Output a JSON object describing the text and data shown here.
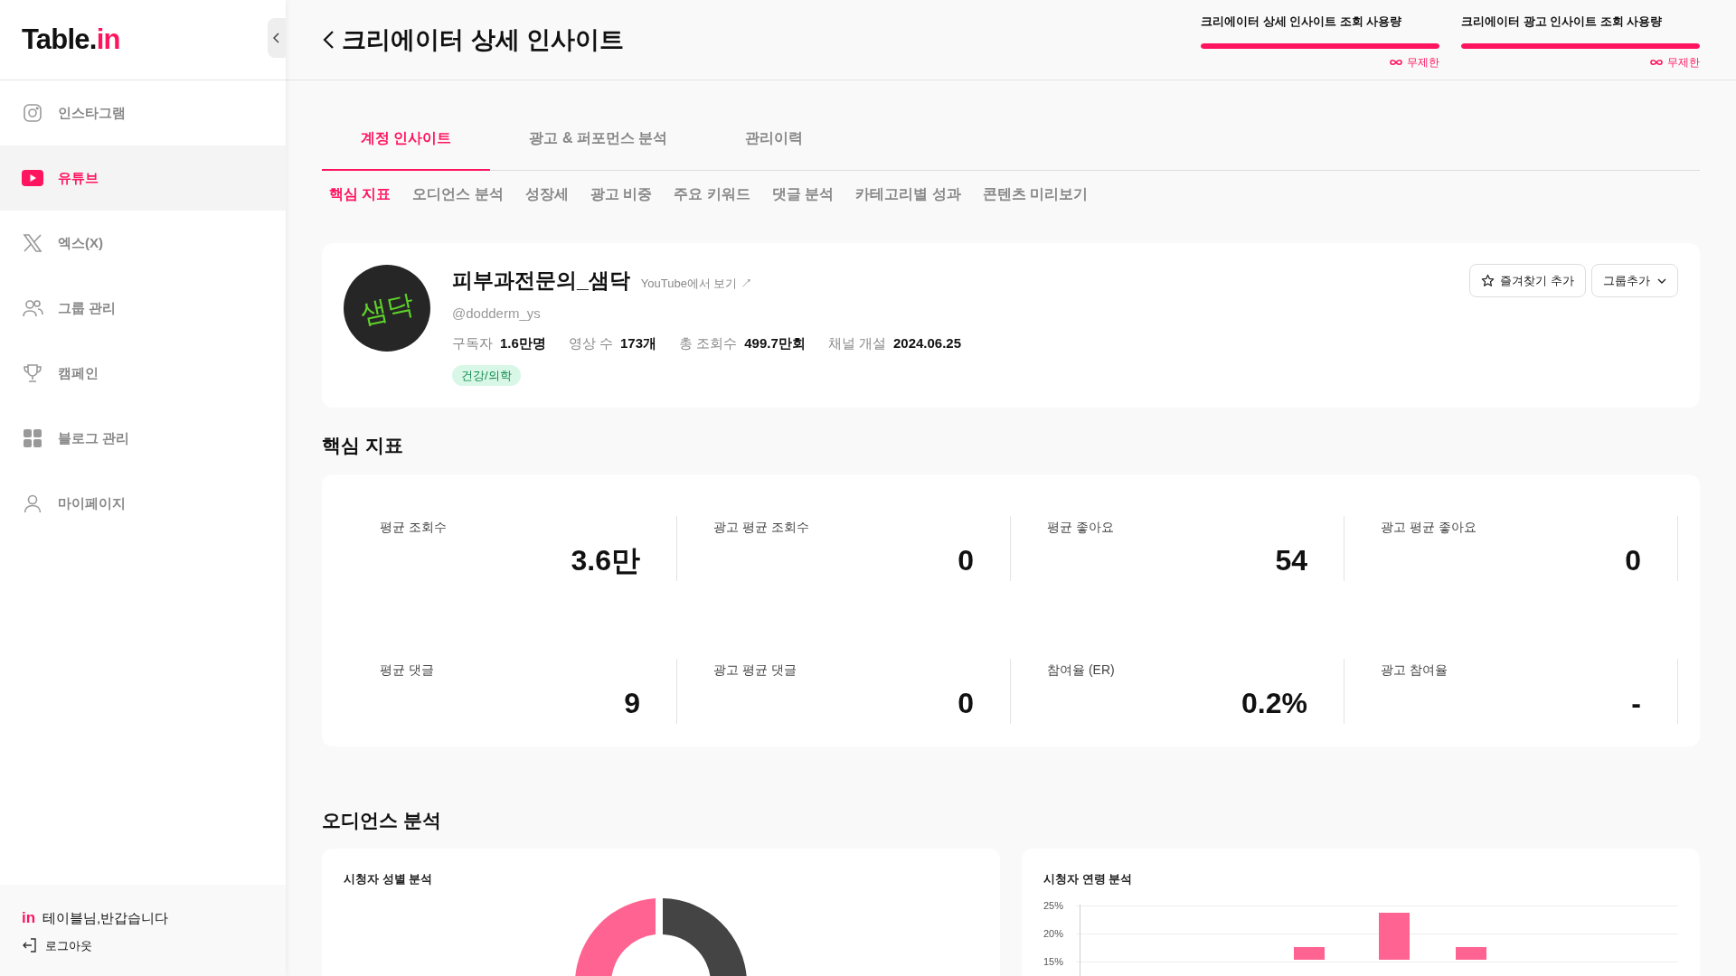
{
  "sidebar": {
    "logo": {
      "main": "Table.",
      "accent": "in"
    },
    "items": [
      {
        "label": "인스타그램",
        "kind": "instagram",
        "selected": false
      },
      {
        "label": "유튜브",
        "kind": "youtube",
        "selected": true
      },
      {
        "label": "엑스(X)",
        "kind": "x",
        "selected": false
      },
      {
        "label": "그룹 관리",
        "kind": "group",
        "selected": false
      },
      {
        "label": "캠페인",
        "kind": "trophy",
        "selected": false
      },
      {
        "label": "블로그 관리",
        "kind": "grid",
        "selected": false
      },
      {
        "label": "마이페이지",
        "kind": "user",
        "selected": false
      }
    ],
    "footer": {
      "badge": "in",
      "greeting": "테이블님,반갑습니다",
      "logout": "로그아웃"
    }
  },
  "header": {
    "title": "크리에이터 상세 인사이트",
    "usage": [
      {
        "label": "크리에이터 상세 인사이트 조회 사용량",
        "level": 1,
        "limit": "무제한"
      },
      {
        "label": "크리에이터 광고 인사이트 조회 사용량",
        "level": 1,
        "limit": "무제한"
      }
    ]
  },
  "tabs": [
    {
      "label": "계정 인사이트",
      "selected": true
    },
    {
      "label": "광고 & 퍼포먼스 분석",
      "selected": false
    },
    {
      "label": "관리이력",
      "selected": false
    }
  ],
  "subtabs": [
    {
      "label": "핵심 지표",
      "selected": true
    },
    {
      "label": "오디언스 분석",
      "selected": false
    },
    {
      "label": "성장세",
      "selected": false
    },
    {
      "label": "광고 비중",
      "selected": false
    },
    {
      "label": "주요 키워드",
      "selected": false
    },
    {
      "label": "댓글 분석",
      "selected": false
    },
    {
      "label": "카테고리별 성과",
      "selected": false
    },
    {
      "label": "콘텐츠 미리보기",
      "selected": false
    }
  ],
  "profile": {
    "avatar_text": "샘닥",
    "name": "피부과전문의_샘닥",
    "link": "YouTube에서 보기 ↗",
    "handle": "@dodderm_ys",
    "stats": [
      {
        "label": "구독자",
        "value": "1.6만명"
      },
      {
        "label": "영상 수",
        "value": "173개"
      },
      {
        "label": "총 조회수",
        "value": "499.7만회"
      },
      {
        "label": "채널 개설",
        "value": "2024.06.25"
      }
    ],
    "tag": "건강/의학",
    "favorite_button": "즐겨찾기 추가",
    "group_button": "그룹추가"
  },
  "metrics": {
    "title": "핵심 지표",
    "items": [
      {
        "label": "평균 조회수",
        "value": "3.6만"
      },
      {
        "label": "광고 평균 조회수",
        "value": "0"
      },
      {
        "label": "평균 좋아요",
        "value": "54"
      },
      {
        "label": "광고 평균 좋아요",
        "value": "0"
      },
      {
        "label": "평균 댓글",
        "value": "9"
      },
      {
        "label": "광고 평균 댓글",
        "value": "0"
      },
      {
        "label": "참여율 (ER)",
        "value": "0.2%"
      },
      {
        "label": "광고 참여율",
        "value": "-"
      }
    ]
  },
  "audience": {
    "title": "오디언스 분석",
    "gender_chart": {
      "title": "시청자 성별 분석"
    },
    "age_chart": {
      "title": "시청자 연령 분석",
      "yticks": [
        "25%",
        "20%",
        "15%"
      ]
    }
  }
}
